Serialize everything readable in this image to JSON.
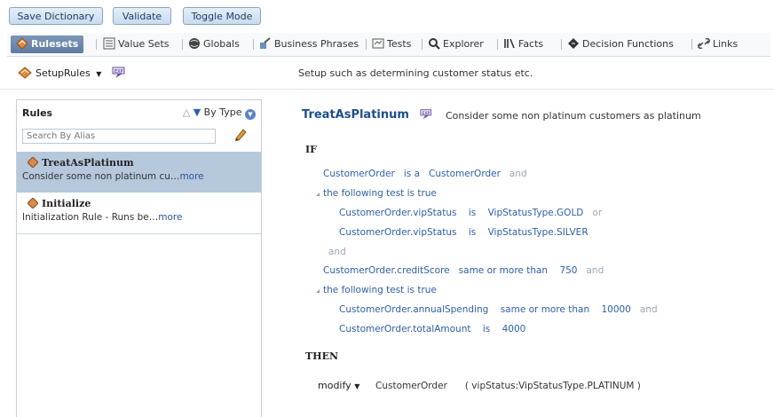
{
  "toolbar": {
    "save_label": "Save Dictionary",
    "validate_label": "Validate",
    "toggle_label": "Toggle Mode"
  },
  "tabs": [
    {
      "label": "Rulesets",
      "icon": "rulesets-icon",
      "active": true
    },
    {
      "label": "Value Sets",
      "icon": "value-sets-icon"
    },
    {
      "label": "Globals",
      "icon": "globals-icon"
    },
    {
      "label": "Business Phrases",
      "icon": "business-phrases-icon"
    },
    {
      "label": "Tests",
      "icon": "tests-icon"
    },
    {
      "label": "Explorer",
      "icon": "explorer-icon"
    },
    {
      "label": "Facts",
      "icon": "facts-icon"
    },
    {
      "label": "Decision Functions",
      "icon": "decision-functions-icon"
    },
    {
      "label": "Links",
      "icon": "links-icon"
    }
  ],
  "ruleset": {
    "name": "SetupRules",
    "description": "Setup such as determining customer status etc."
  },
  "rules_panel": {
    "title": "Rules",
    "sort_label": "By Type",
    "search_placeholder": "Search By Alias",
    "items": [
      {
        "name": "TreatAsPlatinum",
        "desc": "Consider some non platinum cu…",
        "more": "more",
        "selected": true
      },
      {
        "name": "Initialize",
        "desc": "Initialization Rule - Runs be…",
        "more": "more",
        "selected": false
      }
    ]
  },
  "rule": {
    "title": "TreatAsPlatinum",
    "description": "Consider some non platinum customers as platinum",
    "if_label": "IF",
    "then_label": "THEN",
    "conditions": [
      {
        "text": "CustomerOrder",
        "op": "is a",
        "val": "CustomerOrder",
        "conj": "and"
      },
      {
        "text": "the following test is true"
      },
      {
        "text": "CustomerOrder.vipStatus",
        "op": "is",
        "val": "VipStatusType.GOLD",
        "conj": "or"
      },
      {
        "text": "CustomerOrder.vipStatus",
        "op": "is",
        "val": "VipStatusType.SILVER"
      },
      {
        "text": "and"
      },
      {
        "text": "CustomerOrder.creditScore",
        "op": "same or more than",
        "val": "750",
        "conj": "and"
      },
      {
        "text": "the following test is true"
      },
      {
        "text": "CustomerOrder.annualSpending",
        "op": "same or more than",
        "val": "10000",
        "conj": "and"
      },
      {
        "text": "CustomerOrder.totalAmount",
        "op": "is",
        "val": "4000"
      }
    ],
    "action": {
      "verb": "modify",
      "target": "CustomerOrder",
      "args": "( vipStatus:VipStatusType.PLATINUM )"
    }
  }
}
